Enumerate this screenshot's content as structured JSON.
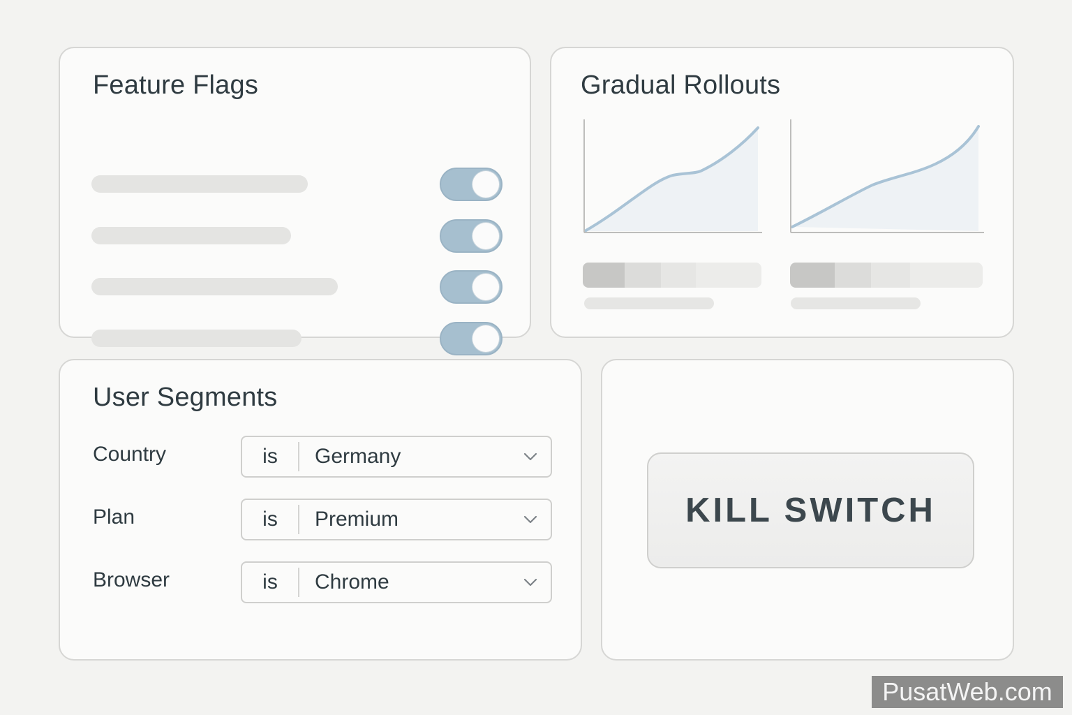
{
  "feature_flags": {
    "title": "Feature Flags",
    "flags": [
      {
        "enabled": true
      },
      {
        "enabled": true
      },
      {
        "enabled": true
      },
      {
        "enabled": true
      }
    ],
    "toggle_color": "#a6bfcf"
  },
  "gradual_rollouts": {
    "title": "Gradual Rollouts",
    "line_color": "#a9c3d6",
    "fill_color": "#eef2f5"
  },
  "user_segments": {
    "title": "User Segments",
    "rules": [
      {
        "label": "Country",
        "operator": "is",
        "value": "Germany"
      },
      {
        "label": "Plan",
        "operator": "is",
        "value": "Premium"
      },
      {
        "label": "Browser",
        "operator": "is",
        "value": "Chrome"
      }
    ]
  },
  "kill_switch": {
    "label": "KILL SWITCH"
  },
  "watermark": "PusatWeb.com"
}
